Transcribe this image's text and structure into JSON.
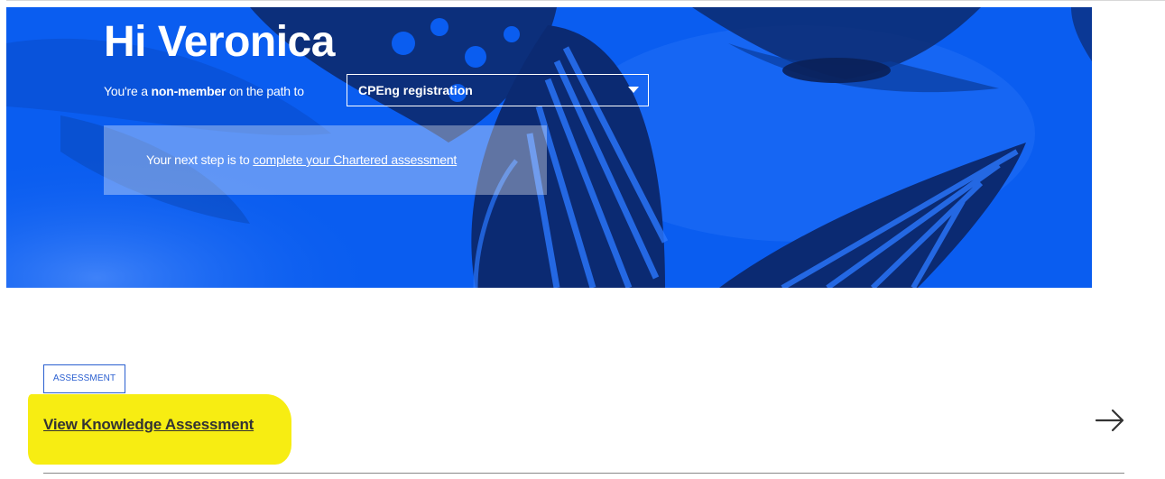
{
  "hero": {
    "greeting": "Hi Veronica",
    "path_prefix": "You're a ",
    "membership": "non-member",
    "path_suffix": " on the path to",
    "selected_path": "CPEng registration",
    "next_step_prefix": "Your next step is to ",
    "next_step_link": "complete your Chartered assessment",
    "background_color": "#0a5df0"
  },
  "card": {
    "tag": "ASSESSMENT",
    "link": "View Knowledge Assessment",
    "highlight_color": "#f7ed12",
    "arrow_icon": "arrow-right-icon"
  }
}
